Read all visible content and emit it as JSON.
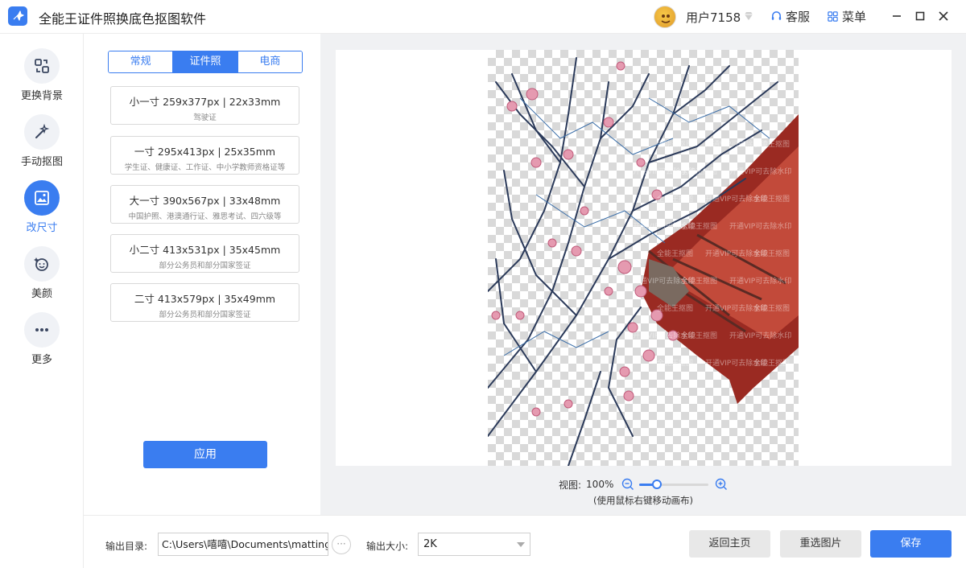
{
  "app": {
    "title": "全能王证件照换底色抠图软件"
  },
  "header": {
    "user_name": "用户7158",
    "service_label": "客服",
    "menu_label": "菜单"
  },
  "sidebar": {
    "items": [
      {
        "label": "更换背景",
        "icon": "swap-background-icon",
        "active": false
      },
      {
        "label": "手动抠图",
        "icon": "magic-wand-icon",
        "active": false
      },
      {
        "label": "改尺寸",
        "icon": "resize-image-icon",
        "active": true
      },
      {
        "label": "美颜",
        "icon": "beauty-face-icon",
        "active": false
      },
      {
        "label": "更多",
        "icon": "more-dots-icon",
        "active": false
      }
    ]
  },
  "panel": {
    "tabs": [
      {
        "label": "常规",
        "active": false
      },
      {
        "label": "证件照",
        "active": true
      },
      {
        "label": "电商",
        "active": false
      }
    ],
    "sizes": [
      {
        "title": "小一寸 259x377px  |  22x33mm",
        "desc": "驾驶证"
      },
      {
        "title": "一寸 295x413px  |  25x35mm",
        "desc": "学生证、健康证、工作证、中小学教师资格证等"
      },
      {
        "title": "大一寸 390x567px  |  33x48mm",
        "desc": "中国护照、港澳通行证、雅思考试、四六级等"
      },
      {
        "title": "小二寸 413x531px  |  35x45mm",
        "desc": "部分公务员和部分国家签证"
      },
      {
        "title": "二寸 413x579px  |  35x49mm",
        "desc": "部分公务员和部分国家签证"
      }
    ],
    "apply_label": "应用"
  },
  "canvas": {
    "zoom_label": "视图:",
    "zoom_value": "100%",
    "zoom_level": 0.25,
    "hint": "(使用鼠标右键移动画布)",
    "watermark_lines": [
      "全能王抠图",
      "开通VIP可去除水印"
    ]
  },
  "bottom": {
    "output_dir_label": "输出目录:",
    "output_dir_value": "C:\\Users\\嘻嘻\\Documents\\matting_w",
    "more_label": "···",
    "output_size_label": "输出大小:",
    "output_size_value": "2K",
    "back_home_label": "返回主页",
    "reselect_label": "重选图片",
    "save_label": "保存"
  },
  "colors": {
    "accent": "#3a7df0",
    "sidebar_bg": "#ffffff",
    "canvas_bg": "#f0f1f3"
  }
}
